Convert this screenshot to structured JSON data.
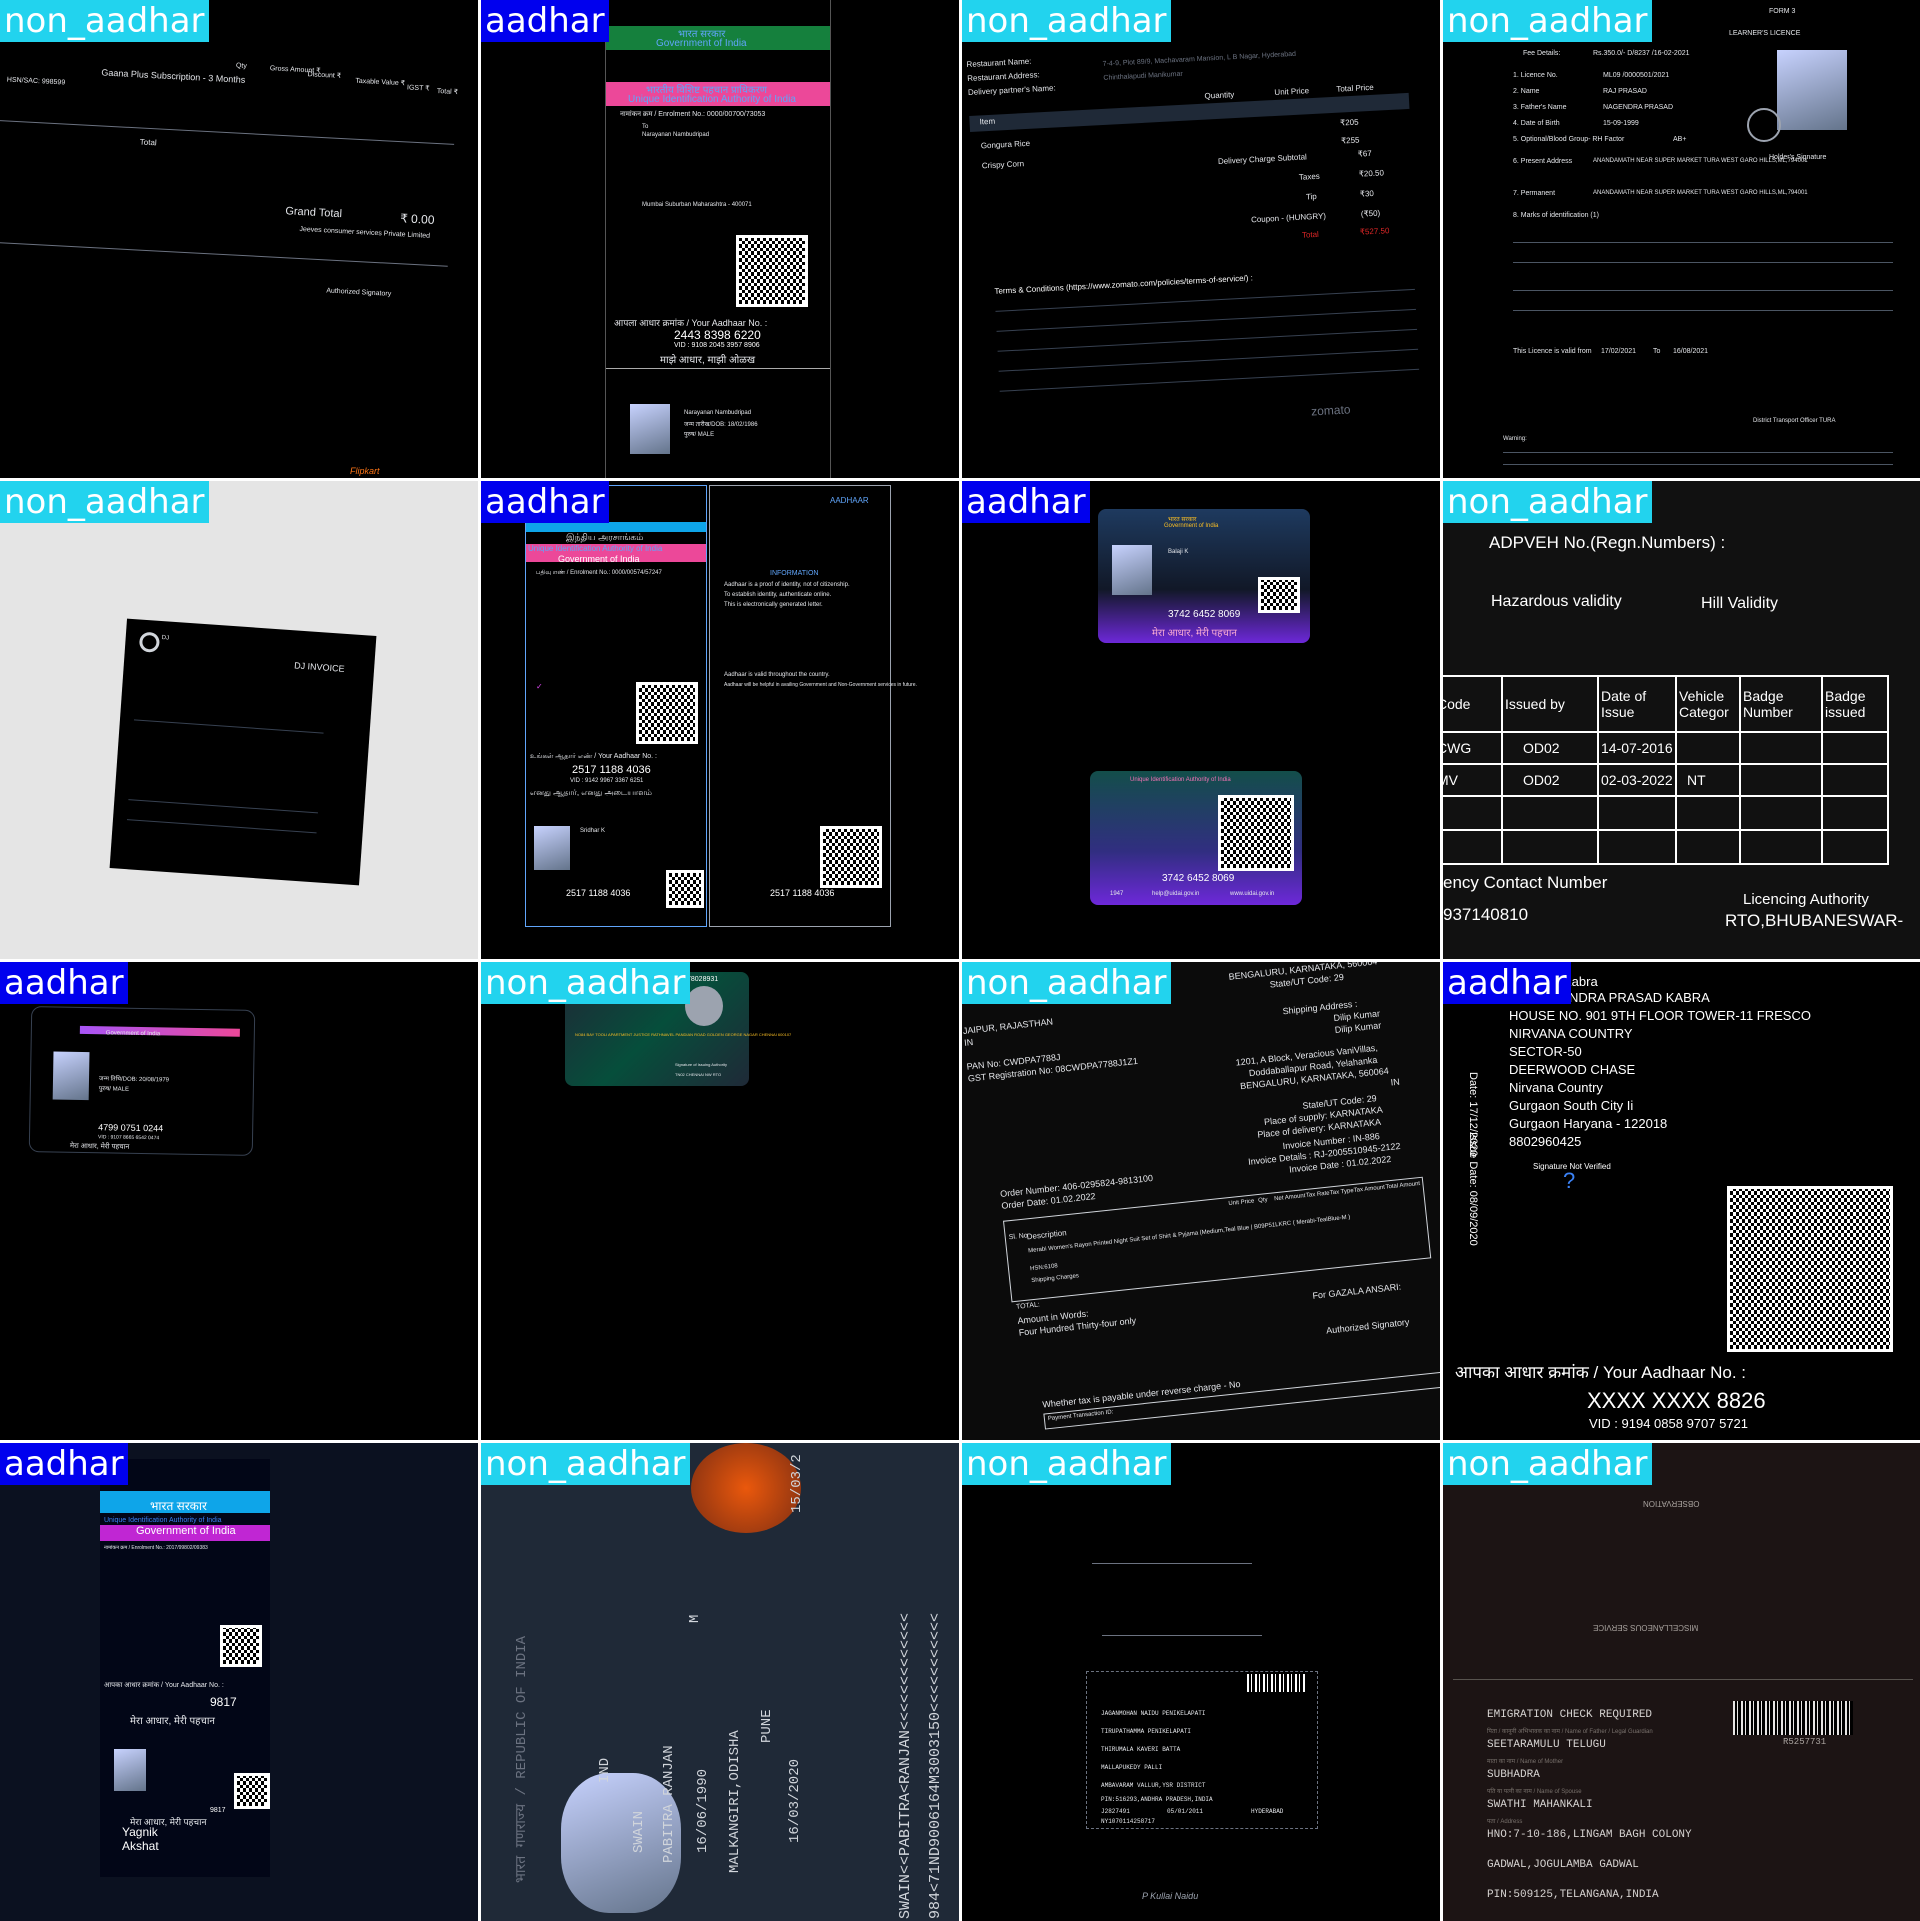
{
  "labels": [
    "non_aadhar",
    "aadhar",
    "non_aadhar",
    "non_aadhar",
    "non_aadhar",
    "aadhar",
    "aadhar",
    "non_aadhar",
    "aadhar",
    "non_aadhar",
    "non_aadhar",
    "aadhar",
    "aadhar",
    "non_aadhar",
    "non_aadhar",
    "non_aadhar"
  ],
  "colors": {
    "aadhar_label_bg": "#0000ee",
    "non_aadhar_label_bg": "#22d3ee",
    "label_text": "#ffffff"
  },
  "t1": {
    "gaana": "Gaana Plus Subscription - 3 Months",
    "hsn": "HSN/SAC: 998599",
    "qty": "Qty",
    "gross": "Gross Amount ₹",
    "discount": "Discount ₹",
    "taxable": "Taxable Value ₹",
    "igst": "IGST ₹",
    "total": "Total ₹",
    "total_row": "Total",
    "grand": "Grand Total",
    "grand_val": "₹ 0.00",
    "jeeves": "Jeeves consumer services Private Limited",
    "sig": "Authorized Signatory",
    "brand": "Flipkart"
  },
  "t2": {
    "gov": "भारत सरकार",
    "gov_en": "Government of India",
    "uidai_hi": "भारतीय विशिष्ट पहचान प्राधिकरण",
    "uidai": "Unique Identification Authority of India",
    "enrol": "नामांकन क्रम / Enrolment No.: 0000/00700/73053",
    "addr1": "To",
    "addr2": "Narayanan Nambudripad",
    "addr3": "Mumbai Suburban Maharashtra - 400071",
    "your_no": "आपला आधार क्रमांक / Your Aadhaar No. :",
    "num": "2443 8398 6220",
    "vid": "VID : 9108 2045 3957 8906",
    "slogan": "माझे आधार, माझी ओळख",
    "name": "Narayanan Nambudripad",
    "dob": "जन्म तारीख/DOB: 18/02/1986",
    "sex": "पुरुष/ MALE"
  },
  "t3": {
    "rest_name": "Restaurant Name:",
    "rest_addr": "Restaurant Address:",
    "addr_val": "7-4-9, Plot 89/9, Machavaram Mansion, L B Nagar, Hyderabad",
    "delivery": "Delivery partner's Name:",
    "dp_val": "Chinthalapudi Manikumar",
    "qty": "Quantity",
    "unit": "Unit Price",
    "totp": "Total Price",
    "item": "Item",
    "i1": "Gongura Rice",
    "i2": "Crispy Corn",
    "p205": "₹205",
    "p255": "₹255",
    "dcs": "Delivery Charge Subtotal",
    "p67": "₹67",
    "taxes": "Taxes",
    "p2050": "₹20.50",
    "tip": "Tip",
    "p30": "₹30",
    "coupon": "Coupon - (HUNGRY)",
    "p50": "(₹50)",
    "total": "Total",
    "p52750": "₹527.50",
    "terms": "Terms & Conditions (https://www.zomato.com/policies/terms-of-service/) :",
    "brand": "zomato"
  },
  "t4": {
    "form": "FORM 3",
    "title": "LEARNER'S LICENCE",
    "fee": "Fee Details:",
    "fee_val": "Rs.350.0/- D/8237 /16-02-2021",
    "l1": "1. Licence No.",
    "l1v": "ML09 /0000501/2021",
    "l2": "2. Name",
    "l2v": "RAJ PRASAD",
    "l3": "3. Father's Name",
    "l3v": "NAGENDRA PRASAD",
    "l4": "4. Date of Birth",
    "l4v": "15-09-1999",
    "l5": "5. Optional/Blood Group- RH Factor",
    "l5v": "AB+",
    "l6": "6. Present Address",
    "l6v": "ANANDAMATH NEAR SUPER MARKET TURA WEST GARO HILLS,ML,794001",
    "l7": "7. Permanent",
    "l7v": "ANANDAMATH NEAR SUPER MARKET TURA WEST GARO HILLS,ML,794001",
    "l8": "8. Marks of identification (1)",
    "holder": "Holder's Signature",
    "valid": "This Licence is valid from",
    "from": "17/02/2021",
    "to_lbl": "To",
    "to": "16/08/2021",
    "authority": "District Transport Officer TURA",
    "warning": "Warning:"
  },
  "t5": {
    "title": "DJ INVOICE",
    "brand": "DJ"
  },
  "t6": {
    "gov": "இந்திய அரசாங்கம்",
    "uidai": "Unique Identification Authority of India",
    "gov_en": "Government of India",
    "enrol": "பதிவு எண் / Enrolment No.: 0000/00574/57247",
    "your_no": "உங்கள் ஆதார் எண் / Your Aadhaar No. :",
    "num": "2517 1188 4036",
    "vid": "VID : 9142 9967 3367 6251",
    "slogan": "எனது ஆதார், எனது அடையாளம்",
    "name": "Sridhar K",
    "info": "INFORMATION",
    "info1": "Aadhaar is a proof of identity, not of citizenship.",
    "info2": "To establish identity, authenticate online.",
    "info3": "This is electronically generated letter.",
    "info4": "Aadhaar is valid throughout the country.",
    "info5": "Aadhaar will be helpful in availing Government and Non-Government services in future.",
    "brand": "AADHAAR",
    "num2": "2517 1188 4036"
  },
  "t7": {
    "gov": "भारत सरकार",
    "gov_en": "Government of India",
    "name": "Balaji K",
    "num": "3742 6452 8069",
    "slogan": "मेरा आधार, मेरी पहचान",
    "uidai": "Unique Identification Authority of India",
    "num2": "3742 6452 8069",
    "phone": "1947",
    "email": "help@uidai.gov.in",
    "web": "www.uidai.gov.in"
  },
  "t8": {
    "regn": "ADPVEH No.(Regn.Numbers) :",
    "haz": "Hazardous validity",
    "hill": "Hill Validity",
    "h1": "Code",
    "h2": "Issued by",
    "h3": "Date of Issue",
    "h4": "Vehicle Categor",
    "h5": "Badge Number",
    "h6": "Badge issued",
    "r1c1": "CWG",
    "r1c2": "OD02",
    "r1c3": "14-07-2016",
    "r2c1": "MV",
    "r2c2": "OD02",
    "r2c3": "02-03-2022",
    "r2c4": "NT",
    "emer": "ency Contact Number",
    "phone": "937140810",
    "auth": "Licencing Authority",
    "rto": "RTO,BHUBANESWAR-"
  },
  "t9": {
    "gov": "Government of India",
    "dob": "जन्म तिथि/DOB: 20/08/1979",
    "sex": "पुरुष/ MALE",
    "num": "4799 0751 0244",
    "vid": "VID : 9107 8665 6542 0474",
    "slogan": "मेरा आधार, मेरी पहचान"
  },
  "t10": {
    "num": "78028931",
    "addr": "NO84 BAY TOOLI APARTMENT JUSTICE RATHNAVEL PANDIAN ROAD GOLDEN GEORGE NAGAR CHENNAI 600107",
    "auth": "Signature of Issuing Authority",
    "code": "TN02 CHENNAI NW RTO"
  },
  "t11": {
    "city": "JAIPUR, RAJASTHAN",
    "in1": "IN",
    "state_top": "BENGALURU, KARNATAKA, 560064",
    "code_top": "State/UT Code: 29",
    "pan": "PAN No: CWDPA7788J",
    "gst": "GST Registration No: 08CWDPA7788J1Z1",
    "ship": "Shipping Address :",
    "ship1": "Dilip Kumar",
    "ship2": "Dilip Kumar",
    "ship3": "1201, A Block, Veracious VaniVillas,",
    "ship4": "Doddaballapur Road, Yelahanka",
    "ship5": "BENGALURU, KARNATAKA, 560064",
    "in2": "IN",
    "code": "State/UT Code: 29",
    "supply": "Place of supply: KARNATAKA",
    "delivery": "Place of delivery: KARNATAKA",
    "inv": "Invoice Number : IN-886",
    "inv_det": "Invoice Details : RJ-2005510945-2122",
    "inv_date": "Invoice Date : 01.02.2022",
    "order_no": "Order Number: 406-0295824-9813100",
    "order_date": "Order Date: 01.02.2022",
    "desc": "Description",
    "item": "Merabi Women's Rayon Printed Night Suit Set of Shirt & Pyjama (Medium,Teal Blue | B09P51LKRC ( Merabi-TealBlue-M )",
    "hsn": "HSN:6108",
    "shipping": "Shipping Charges",
    "total": "TOTAL:",
    "words": "Amount in Words:",
    "words_val": "Four Hundred Thirty-four only",
    "for": "For GAZALA ANSARI:",
    "auth": "Authorized Signatory",
    "reverse": "Whether tax is payable under reverse charge - No",
    "payment": "Payment Transaction ID:",
    "sl": "Sl. No",
    "unit": "Unit Price",
    "qty": "Qty",
    "net": "Net Amount",
    "rate": "Tax Rate",
    "type": "Tax Type",
    "tax_amt": "Tax Amount",
    "tot_amt": "Total Amount"
  },
  "t12": {
    "name": "Kabra",
    "co": "C/O RAJENDRA PRASAD KABRA",
    "a1": "HOUSE NO. 901 9TH FLOOR TOWER-11 FRESCO",
    "a2": "NIRVANA COUNTRY",
    "a3": "SECTOR-50",
    "a4": "DEERWOOD CHASE",
    "a5": "Nirvana Country",
    "a6": "Gurgaon South City Ii",
    "a7": "Gurgaon Haryana - 122018",
    "phone": "8802960425",
    "date1": "Date: 17/12/2020",
    "date2": "Issue Date: 08/09/2020",
    "sig": "Signature Not Verified",
    "your_no": "आपका आधार क्रमांक / Your Aadhaar No. :",
    "num": "XXXX XXXX 8826",
    "vid": "VID : 9194 0858 9707 5721"
  },
  "t13": {
    "gov": "भारत सरकार",
    "uidai": "Unique Identification Authority of India",
    "gov_en": "Government of India",
    "enrol": "नामांकन क्रम / Enrolment No.: 2017/99802/09383",
    "your_no": "आपका आधार क्रमांक / Your Aadhaar No. :",
    "num": "9817",
    "slogan": "मेरा आधार, मेरी पहचान",
    "num2": "9817",
    "name1": "Yagnik",
    "name2": "Akshat"
  },
  "t14": {
    "country": "भारत गणराज्य / REPUBLIC OF INDIA",
    "surname": "SWAIN",
    "given": "PABITRA RANJAN",
    "sex": "M",
    "dob": "16/06/1990",
    "place": "MALKANGIRI,ODISHA",
    "issue_place": "PUNE",
    "issue": "16/03/2020",
    "expiry": "15/03/2",
    "mrz1": "SWAIN<<PABITRA<RANJAN<<<<<<<<<<<<<",
    "mrz2": "984<71ND9006164M3003150<<<<<<<<<<<",
    "code": "IND",
    "type": "P"
  },
  "t15": {
    "r1": "JAGANMOHAN NAIDU PENIKELAPATI",
    "r2": "TIRUPATHAMMA PENIKELAPATI",
    "r3": "THIRUMALA KAVERI BATTA",
    "r4": "MALLAPUKEDY PALLI",
    "r5": "AMBAVARAM VALLUR,YSR DISTRICT",
    "r6": "PIN:516293,ANDHRA PRADESH,INDIA",
    "r7a": "J2827491",
    "r7b": "05/01/2011",
    "r7c": "HYDERABAD",
    "r8": "NY1070114258717",
    "sig": "P Kullai Naidu"
  },
  "t16": {
    "top": "OBSERVATION",
    "mid": "MISCELLANEOUS SERVICE",
    "emig": "EMIGRATION CHECK REQUIRED",
    "l1": "पिता / कानूनी अभिभावक का नाम / Name of Father / Legal Guardian",
    "v1": "SEETARAMULU TELUGU",
    "l2": "माता का नाम / Name of Mother",
    "v2": "SUBHADRA",
    "l3": "पति या पत्नी का नाम / Name of Spouse",
    "v3": "SWATHI MAHANKALI",
    "l4": "पता / Address",
    "v4": "HNO:7-10-186,LINGAM BAGH COLONY",
    "v5": "GADWAL,JOGULAMBA GADWAL",
    "v6": "PIN:509125,TELANGANA,INDIA",
    "barcode": "R5257731"
  }
}
